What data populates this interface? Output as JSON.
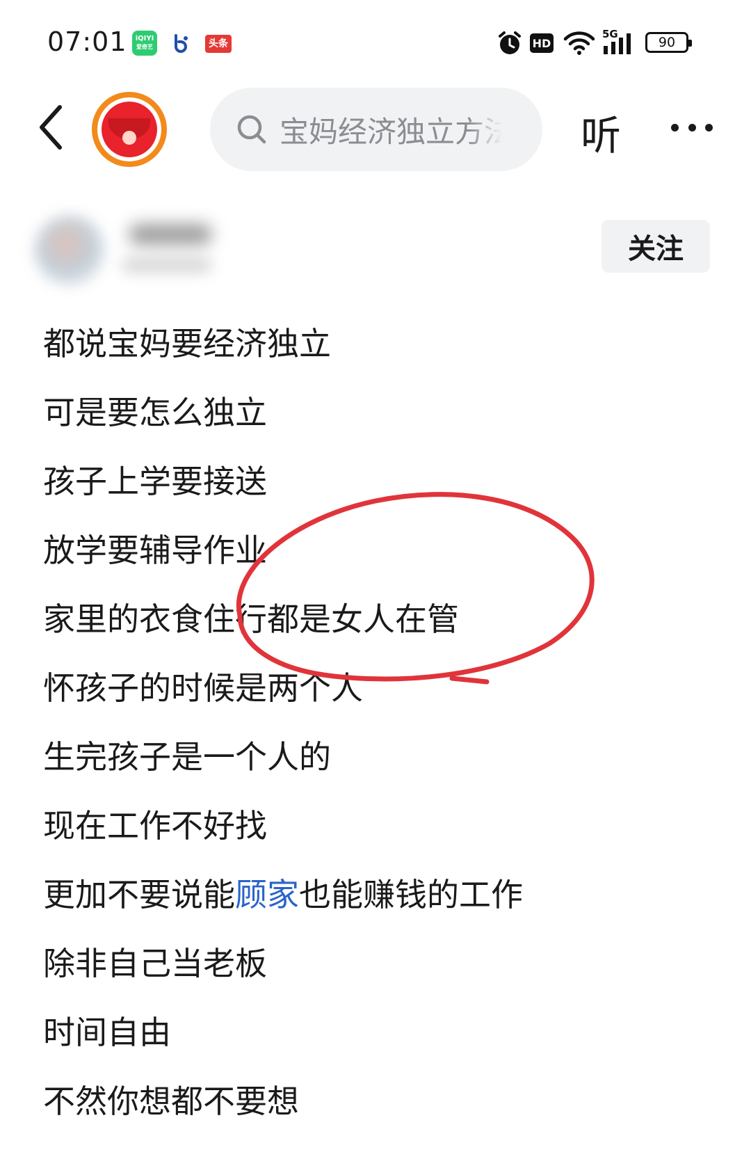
{
  "status_bar": {
    "time": "07:01",
    "apps": [
      "iqiyi-app-icon",
      "baidu-app-icon",
      "toutiao-app-icon"
    ],
    "iqiyi_label_top": "iQIYI",
    "iqiyi_label_bottom": "爱奇艺",
    "toutiao_label": "头条",
    "hd_label": "HD",
    "network_label": "5G",
    "battery": "90"
  },
  "header": {
    "search_placeholder": "宝妈经济独立方法",
    "listen_label": "听"
  },
  "author": {
    "follow_label": "关注"
  },
  "post": {
    "lines": [
      "都说宝妈要经济独立",
      "可是要怎么独立",
      "孩子上学要接送",
      "放学要辅导作业",
      "家里的衣食住行都是女人在管",
      "怀孩子的时候是两个人",
      "生完孩子是一个人的",
      "现在工作不好找",
      "除非自己当老板",
      "时间自由",
      "不然你想都不要想"
    ],
    "line9_before": "更加不要说能",
    "line9_link": "顾家",
    "line9_after": "也能赚钱的工作"
  },
  "colors": {
    "link": "#2a63c9",
    "annotation": "#e0343a",
    "avatar_ring": "#f28a1c",
    "redpacket": "#e8232c"
  }
}
